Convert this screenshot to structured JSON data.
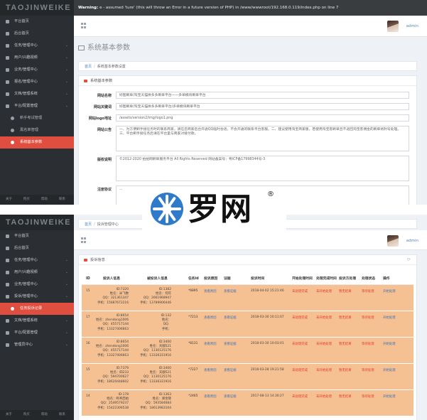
{
  "brand": "TAOJINWEIKE",
  "top_panel": {
    "error_text": "e - assumed 'ture' (this will throw an Error in a future version of PHP) in /www/wwwroot/192.168.0.119/index.php on line 7",
    "user": "admin",
    "page_title": "系统基本参数",
    "breadcrumb": {
      "home": "首页",
      "current": "系统基本参数设置"
    },
    "box_title": "系统基本参数",
    "sidebar": [
      {
        "label": "平台首页",
        "sub": false,
        "caret": false,
        "active": false
      },
      {
        "label": "后台首页",
        "sub": false,
        "caret": false,
        "active": false
      },
      {
        "label": "任务/管理中心",
        "sub": false,
        "caret": true,
        "active": false
      },
      {
        "label": "用户/兴趣视频",
        "sub": false,
        "caret": true,
        "active": false
      },
      {
        "label": "业务/管理中心",
        "sub": false,
        "caret": true,
        "active": false
      },
      {
        "label": "报名/管理中心",
        "sub": false,
        "caret": true,
        "active": false
      },
      {
        "label": "文档/管理系统",
        "sub": false,
        "caret": true,
        "active": false
      },
      {
        "label": "平台/配置管理",
        "sub": false,
        "caret": true,
        "active": false
      },
      {
        "label": "新手考试管理",
        "sub": true,
        "caret": false,
        "active": false
      },
      {
        "label": "黑名单管理",
        "sub": true,
        "caret": false,
        "active": false
      },
      {
        "label": "系统基本参数",
        "sub": true,
        "caret": false,
        "active": true
      }
    ],
    "footer": [
      "关于",
      "购买",
      "帮助",
      "联系"
    ],
    "form": [
      {
        "label": "网站名称",
        "value": "好图刷单/淘宝天猫拼多多刷单平台——多单模块刷单平台"
      },
      {
        "label": "网站关键词",
        "value": "好图刷单/淘宝天猫拼多多刷单平台/多单模块刷单平台"
      },
      {
        "label": "网站logo地址",
        "value": "/assets/version2/img/logo1.png"
      },
      {
        "label": "网站公告",
        "value": "一、为方便刷手接任务时的联系商家，请在您商家后台开通QQ临时会话，不会开通的联系平台客服。二、建议使用淘宝商家版，若使用淘宝客刷单且不返回淘宝客佣金的刷单将封号处理。三、平台刷手接任务后请在平台里与商家对接付款。"
      },
      {
        "label": "版权说明",
        "value": "©2012-2020 拍拍网刷单服务平台 All Rights Reserved 网站备案号：粤ICP备17998344号-3"
      },
      {
        "label": "注册协议",
        "value": "..."
      }
    ]
  },
  "bottom_panel": {
    "user": "admin",
    "breadcrumb": {
      "home": "首页",
      "current": "投诉管理中心"
    },
    "box_title": "投诉信息",
    "sidebar": [
      {
        "label": "平台首页",
        "sub": false,
        "caret": false,
        "active": false
      },
      {
        "label": "后台首页",
        "sub": false,
        "caret": false,
        "active": false
      },
      {
        "label": "任务/管理中心",
        "sub": false,
        "caret": true,
        "active": false
      },
      {
        "label": "用户/兴趣视频",
        "sub": false,
        "caret": true,
        "active": false
      },
      {
        "label": "业务/管理中心",
        "sub": false,
        "caret": true,
        "active": false
      },
      {
        "label": "投诉/管理中心",
        "sub": false,
        "caret": true,
        "active": false
      },
      {
        "label": "任务投诉记录",
        "sub": true,
        "caret": false,
        "active": true
      },
      {
        "label": "文档/管理系统",
        "sub": false,
        "caret": true,
        "active": false
      },
      {
        "label": "平台/配置管理",
        "sub": false,
        "caret": true,
        "active": false
      },
      {
        "label": "管理员中心",
        "sub": false,
        "caret": true,
        "active": false
      }
    ],
    "footer": [
      "关于",
      "购买",
      "帮助",
      "联系"
    ],
    "columns": [
      "ID",
      "投诉人信息",
      "被投诉人信息",
      "任务id",
      "投诉原因",
      "证据",
      "投诉时间",
      "开始处理时间",
      "处理完成时间",
      "投诉方处理",
      "处理状态",
      "操作"
    ],
    "rows": [
      {
        "id": "15",
        "a": [
          "ID:7320",
          "姓名：米飞数",
          "QQ：321361347",
          "手机：15687672216"
        ],
        "b": [
          "ID:1382",
          "姓名：何年",
          "QQ：2661968947",
          "手机：13789906446"
        ],
        "task": "*6895",
        "time": "2018-04-02 15:21:46"
      },
      {
        "id": "17",
        "a": [
          "ID:8654",
          "姓名：zhendong1006",
          "QQ：455717144",
          "手机：13327406663"
        ],
        "b": [
          "ID:132",
          "姓名：",
          "QQ：",
          "手机："
        ],
        "task": "*7213",
        "time": "2018-03-30 10:11:07"
      },
      {
        "id": "16",
        "a": [
          "ID:8654",
          "姓名：zhendong1006",
          "QQ：455717144",
          "手机：13327406663"
        ],
        "b": [
          "ID:3400",
          "姓名：天顺521",
          "QQ：1130125176",
          "手机：13336331916"
        ],
        "task": "*8131",
        "time": "2018-03-30 10:03:01"
      },
      {
        "id": "15",
        "a": [
          "ID:7379",
          "姓名：四233",
          "QQ：594700627",
          "手机：18620448602"
        ],
        "b": [
          "ID:3400",
          "姓名：天顺521",
          "QQ：1130125176",
          "手机：13336331916"
        ],
        "task": "*7227",
        "time": "2018-03-28 19:21:58"
      },
      {
        "id": "14",
        "a": [
          "ID:178",
          "姓名：咚咚西拍",
          "QQ：2549579237",
          "手机：15422306538"
        ],
        "b": [
          "ID:1363",
          "姓名：郑金晓",
          "QQ：593584684",
          "手机：18613983104"
        ],
        "task": "*2465",
        "time": "2017-08-13 14:30:27"
      }
    ],
    "row_texts": {
      "reason": "查看原因",
      "proof": "查看证据",
      "start": "未处理完成",
      "finish": "未开始处理",
      "side": "暂无结果",
      "state": "等待处理",
      "op": "开始处理"
    }
  },
  "watermark": {
    "text": "罗网",
    "reg": "®"
  },
  "colors": {
    "sidebar": "#2b2f33",
    "accent_red": "#e04e3f",
    "row_orange": "#f6c192",
    "link_blue": "#3d6fb6"
  }
}
